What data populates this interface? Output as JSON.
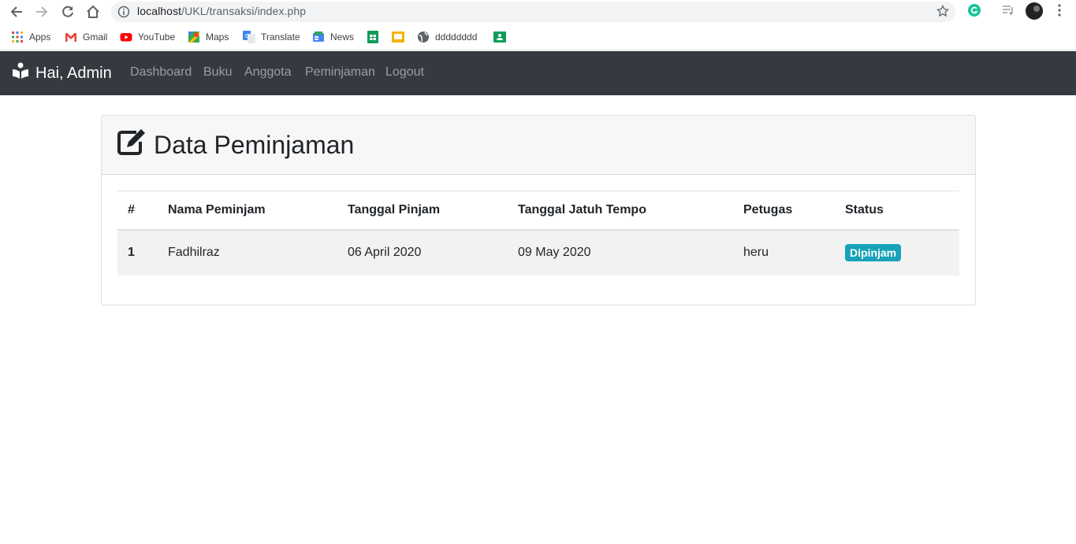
{
  "browser": {
    "url_host": "localhost",
    "url_path": "/UKL/transaksi/index.php",
    "bookmarks": [
      {
        "label": "Apps",
        "icon": "apps-grid-icon"
      },
      {
        "label": "Gmail",
        "icon": "gmail-icon"
      },
      {
        "label": "YouTube",
        "icon": "youtube-icon"
      },
      {
        "label": "Maps",
        "icon": "maps-icon"
      },
      {
        "label": "Translate",
        "icon": "translate-icon"
      },
      {
        "label": "News",
        "icon": "news-icon"
      },
      {
        "label": "",
        "icon": "sheets-icon"
      },
      {
        "label": "",
        "icon": "slides-icon"
      },
      {
        "label": "dddddddd",
        "icon": "globe-icon"
      },
      {
        "label": "",
        "icon": "classroom-icon"
      }
    ]
  },
  "navbar": {
    "brand": "Hai, Admin",
    "links": [
      "Dashboard",
      "Buku",
      "Anggota",
      "Peminjaman",
      "Logout"
    ]
  },
  "card": {
    "title": "Data Peminjaman",
    "table": {
      "columns": [
        "#",
        "Nama Peminjam",
        "Tanggal Pinjam",
        "Tanggal Jatuh Tempo",
        "Petugas",
        "Status"
      ],
      "rows": [
        {
          "no": "1",
          "nama": "Fadhilraz",
          "tgl_pinjam": "06 April 2020",
          "tgl_tempo": "09 May 2020",
          "petugas": "heru",
          "status": "Dipinjam"
        }
      ]
    }
  },
  "colors": {
    "navbar_bg": "#343a40",
    "badge_info": "#17a2b8",
    "card_header_bg": "#f7f7f7"
  }
}
